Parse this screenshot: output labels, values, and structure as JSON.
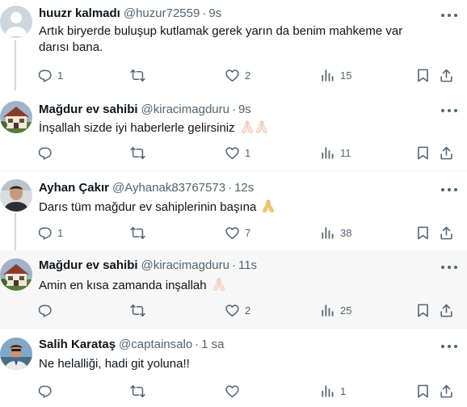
{
  "tweets": [
    {
      "name": "huuzr kalmadı",
      "handle": "@huzur72559",
      "time": "9s",
      "text": "Artık biryerde buluşup kutlamak gerek yarın da benim mahkeme var darısı bana.",
      "emoji": "",
      "avatar": "default",
      "stats": {
        "replies": "1",
        "retweets": "",
        "likes": "2",
        "views": "15"
      }
    },
    {
      "name": "Mağdur ev sahibi",
      "handle": "@kiracimagduru",
      "time": "9s",
      "text": "İnşallah sizde iyi haberlerle gelirsiniz",
      "emoji": "🙏🏻🙏🏻",
      "avatar": "house",
      "stats": {
        "replies": "",
        "retweets": "",
        "likes": "1",
        "views": "11"
      }
    },
    {
      "name": "Ayhan Çakır",
      "handle": "@Ayhanak83767573",
      "time": "12s",
      "text": "Darıs tüm mağdur ev sahiplerinin başına",
      "emoji": "🙏",
      "avatar": "person",
      "stats": {
        "replies": "1",
        "retweets": "",
        "likes": "7",
        "views": "38"
      }
    },
    {
      "name": "Mağdur ev sahibi",
      "handle": "@kiracimagduru",
      "time": "11s",
      "text": "Amin en kısa zamanda inşallah",
      "emoji": "🙏🏻",
      "avatar": "house",
      "stats": {
        "replies": "",
        "retweets": "",
        "likes": "2",
        "views": "25"
      }
    },
    {
      "name": "Salih Karataş",
      "handle": "@captainsalo",
      "time": "1 sa",
      "text": "Ne helalliği, hadi git yoluna!!",
      "emoji": "",
      "avatar": "man",
      "stats": {
        "replies": "",
        "retweets": "",
        "likes": "",
        "views": "1"
      }
    }
  ],
  "colors": {
    "text": "#0f1419",
    "secondary": "#536471",
    "divider": "#eff3f4",
    "highlight": "#f7f7f7",
    "thread": "#cfd9de"
  },
  "icons": [
    "comment-icon",
    "retweet-icon",
    "heart-icon",
    "views-icon",
    "bookmark-icon",
    "share-icon",
    "more-icon",
    "pray-emoji"
  ]
}
